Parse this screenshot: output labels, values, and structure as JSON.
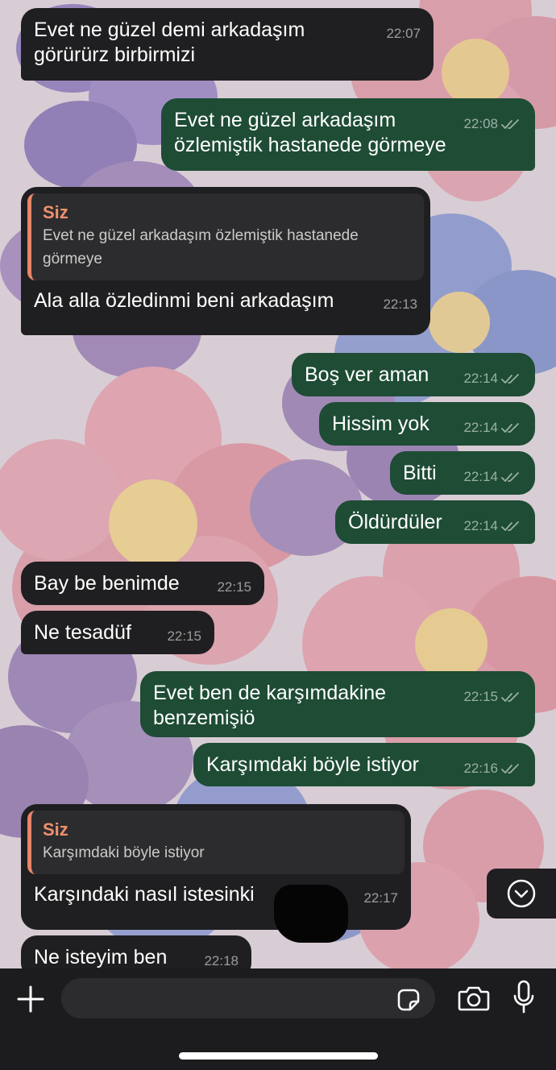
{
  "colors": {
    "incoming_bubble": "#1f1f21",
    "outgoing_bubble": "#1e4c35",
    "quote_accent": "#e8866a",
    "bottom_bar": "#1c1c1e"
  },
  "messages": [
    {
      "dir": "in",
      "text": "Evet ne güzel demi arkadaşım görürürz birbirmizi",
      "time": "22:07"
    },
    {
      "dir": "out",
      "text": "Evet ne güzel arkadaşım özlemiştik hastanede görmeye",
      "time": "22:08",
      "read": true
    },
    {
      "dir": "in",
      "reply": {
        "author": "Siz",
        "text": "Evet ne güzel arkadaşım özlemiştik hastanede görmeye"
      },
      "text": "Ala alla özledinmi beni arkadaşım",
      "time": "22:13"
    },
    {
      "dir": "out",
      "text": "Boş ver aman",
      "time": "22:14",
      "read": true
    },
    {
      "dir": "out",
      "text": "Hissim yok",
      "time": "22:14",
      "read": true
    },
    {
      "dir": "out",
      "text": "Bitti",
      "time": "22:14",
      "read": true
    },
    {
      "dir": "out",
      "text": "Öldürdüler",
      "time": "22:14",
      "read": true
    },
    {
      "dir": "in",
      "text": "Bay be benimde",
      "time": "22:15"
    },
    {
      "dir": "in",
      "text": "Ne tesadüf",
      "time": "22:15"
    },
    {
      "dir": "out",
      "text": "Evet ben de karşımdakine benzemişiö",
      "time": "22:15",
      "read": true
    },
    {
      "dir": "out",
      "text": "Karşımdaki böyle istiyor",
      "time": "22:16",
      "read": true
    },
    {
      "dir": "in",
      "reply": {
        "author": "Siz",
        "text": "Karşımdaki böyle istiyor"
      },
      "text": "Karşındaki nasıl istesinki",
      "time": "22:17"
    },
    {
      "dir": "in",
      "text": "Ne isteyim ben",
      "time": "22:18"
    }
  ],
  "icons": {
    "scroll_down": "chevron-down-circle-icon",
    "attach": "plus-icon",
    "sticker": "sticker-icon",
    "camera": "camera-icon",
    "mic": "microphone-icon"
  }
}
